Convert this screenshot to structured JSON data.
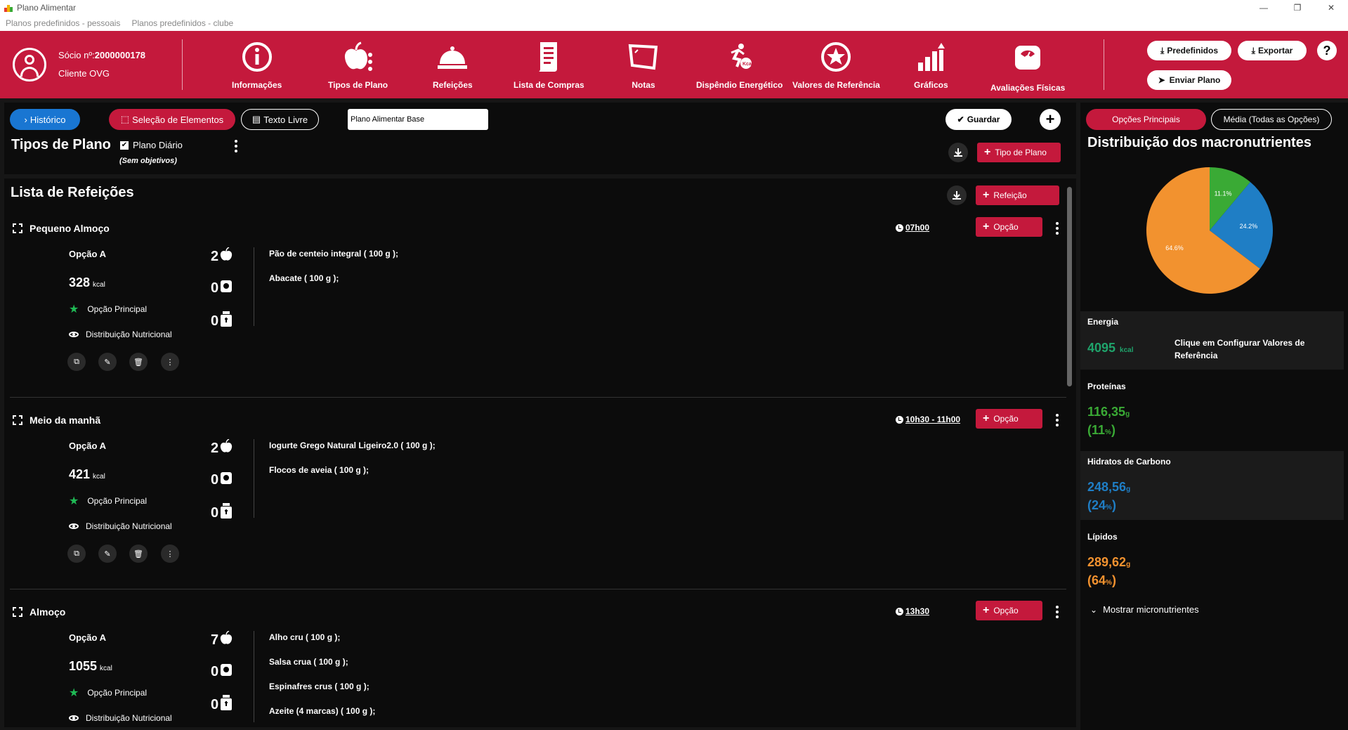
{
  "window": {
    "title": "Plano Alimentar",
    "minimize": "—",
    "restore": "❐",
    "close": "✕"
  },
  "menu": [
    "Planos predefinidos - pessoais",
    "Planos predefinidos - clube"
  ],
  "user": {
    "socio_label": "Sócio nº:",
    "socio_number": "2000000178",
    "client": "Cliente OVG"
  },
  "nav": [
    {
      "label": "Informações"
    },
    {
      "label": "Tipos de Plano"
    },
    {
      "label": "Refeições"
    },
    {
      "label": "Lista de Compras"
    },
    {
      "label": "Notas"
    },
    {
      "label": "Dispêndio Energético"
    },
    {
      "label": "Valores de Referência"
    },
    {
      "label": "Gráficos"
    },
    {
      "label": "Avaliações Físicas"
    }
  ],
  "header_buttons": {
    "predefinidos": "Predefinidos",
    "exportar": "Exportar",
    "enviar": "Enviar Plano",
    "help": "?"
  },
  "toolbar": {
    "historico": "Histórico",
    "selecao": "Seleção de Elementos",
    "texto_livre": "Texto Livre",
    "plan_name": "Plano Alimentar Base",
    "guardar": "Guardar"
  },
  "tipos": {
    "title": "Tipos de Plano",
    "checkbox_label": "Plano Diário",
    "note": "(Sem objetivos)",
    "add_button": "Tipo de Plano"
  },
  "lista": {
    "title": "Lista de Refeições",
    "add_button": "Refeição",
    "option_button": "Opção",
    "meals": [
      {
        "name": "Pequeno Almoço",
        "time": "07h00",
        "option": "Opção A",
        "kcal": "328",
        "kcal_unit": "kcal",
        "principal": "Opção Principal",
        "dist": "Distribuição Nutricional",
        "counts": [
          "2",
          "0",
          "0"
        ],
        "foods": [
          "Pão de centeio integral ( 100 g );",
          "Abacate ( 100 g );"
        ]
      },
      {
        "name": "Meio da manhã",
        "time": "10h30 - 11h00",
        "option": "Opção A",
        "kcal": "421",
        "kcal_unit": "kcal",
        "principal": "Opção Principal",
        "dist": "Distribuição Nutricional",
        "counts": [
          "2",
          "0",
          "0"
        ],
        "foods": [
          "Iogurte Grego Natural Ligeiro2.0 ( 100 g );",
          "Flocos de aveia ( 100 g );"
        ]
      },
      {
        "name": "Almoço",
        "time": "13h30",
        "option": "Opção A",
        "kcal": "1055",
        "kcal_unit": "kcal",
        "principal": "Opção Principal",
        "dist": "Distribuição Nutricional",
        "counts": [
          "7",
          "0",
          "0"
        ],
        "foods": [
          "Alho cru ( 100 g );",
          "Salsa crua ( 100 g );",
          "Espinafres crus ( 100 g );",
          "Azeite (4 marcas) ( 100 g );"
        ]
      }
    ]
  },
  "right": {
    "tab_principal": "Opções Principais",
    "tab_media": "Média (Todas as Opções)",
    "macro_title": "Distribuição dos macronutrientes",
    "energia_label": "Energia",
    "energia_value": "4095",
    "energia_unit": "kcal",
    "config_hint": "Clique em Configurar Valores de Referência",
    "proteinas_label": "Proteínas",
    "proteinas_value": "116,35",
    "proteinas_pct": "11",
    "hidratos_label": "Hidratos de Carbono",
    "hidratos_value": "248,56",
    "hidratos_pct": "24",
    "lipidos_label": "Lípidos",
    "lipidos_value": "289,62",
    "lipidos_pct": "64",
    "unit_g": "g",
    "unit_pct": "%",
    "micro_toggle": "Mostrar micronutrientes"
  },
  "chart_data": {
    "type": "pie",
    "categories": [
      "Proteínas",
      "Hidratos de Carbono",
      "Lípidos"
    ],
    "values": [
      11.1,
      24.2,
      64.6
    ],
    "labels": [
      "11.1%",
      "24.2%",
      "64.6%"
    ],
    "colors": [
      "#3aaa35",
      "#1f7ec5",
      "#f2922f"
    ]
  }
}
